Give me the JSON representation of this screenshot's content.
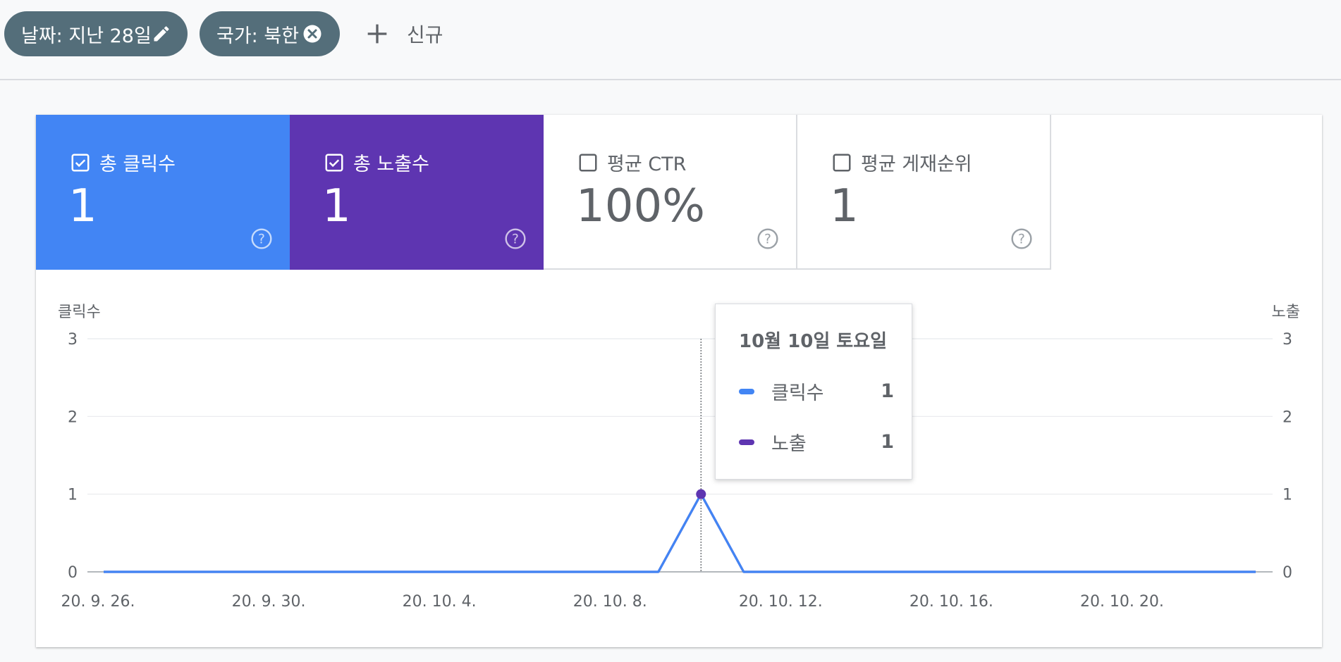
{
  "filters": {
    "chips": [
      {
        "label": "날짜: 지난 28일",
        "action_icon": "pencil-icon"
      },
      {
        "label": "국가: 북한",
        "action_icon": "close-circle-icon"
      }
    ],
    "new_label": "신규"
  },
  "metrics": [
    {
      "label": "총 클릭수",
      "value": "1",
      "checked": true,
      "color": "#4285f4"
    },
    {
      "label": "총 노출수",
      "value": "1",
      "checked": true,
      "color": "#5e35b1"
    },
    {
      "label": "평균 CTR",
      "value": "100%",
      "checked": false,
      "color": "#ffffff"
    },
    {
      "label": "평균 게재순위",
      "value": "1",
      "checked": false,
      "color": "#ffffff"
    }
  ],
  "chart": {
    "left_axis_title": "클릭수",
    "right_axis_title": "노출"
  },
  "tooltip": {
    "title": "10월 10일 토요일",
    "rows": [
      {
        "name": "클릭수",
        "value": "1",
        "color": "#4285f4"
      },
      {
        "name": "노출",
        "value": "1",
        "color": "#5e35b1"
      }
    ]
  },
  "chart_data": {
    "type": "line",
    "x": [
      "20. 9. 26.",
      "20. 9. 27.",
      "20. 9. 28.",
      "20. 9. 29.",
      "20. 9. 30.",
      "20. 10. 1.",
      "20. 10. 2.",
      "20. 10. 3.",
      "20. 10. 4.",
      "20. 10. 5.",
      "20. 10. 6.",
      "20. 10. 7.",
      "20. 10. 8.",
      "20. 10. 9.",
      "20. 10. 10.",
      "20. 10. 11.",
      "20. 10. 12.",
      "20. 10. 13.",
      "20. 10. 14.",
      "20. 10. 15.",
      "20. 10. 16.",
      "20. 10. 17.",
      "20. 10. 18.",
      "20. 10. 19.",
      "20. 10. 20.",
      "20. 10. 21.",
      "20. 10. 22.",
      "20. 10. 23."
    ],
    "x_tick_labels": [
      "20. 9. 26.",
      "20. 9. 30.",
      "20. 10. 4.",
      "20. 10. 8.",
      "20. 10. 12.",
      "20. 10. 16.",
      "20. 10. 20."
    ],
    "series": [
      {
        "name": "클릭수",
        "color": "#4285f4",
        "values": [
          0,
          0,
          0,
          0,
          0,
          0,
          0,
          0,
          0,
          0,
          0,
          0,
          0,
          0,
          1,
          0,
          0,
          0,
          0,
          0,
          0,
          0,
          0,
          0,
          0,
          0,
          0,
          0
        ]
      },
      {
        "name": "노출",
        "color": "#5e35b1",
        "values": [
          0,
          0,
          0,
          0,
          0,
          0,
          0,
          0,
          0,
          0,
          0,
          0,
          0,
          0,
          1,
          0,
          0,
          0,
          0,
          0,
          0,
          0,
          0,
          0,
          0,
          0,
          0,
          0
        ]
      }
    ],
    "ylabel": "클릭수",
    "y2label": "노출",
    "ylim": [
      0,
      3
    ],
    "y_ticks": [
      "0",
      "1",
      "2",
      "3"
    ],
    "grid": true,
    "hover_index": 14
  }
}
